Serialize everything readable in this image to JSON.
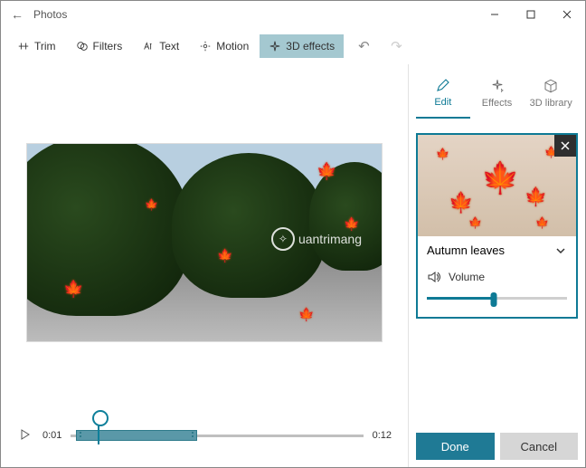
{
  "window": {
    "title": "Photos"
  },
  "toolbar": {
    "trim": "Trim",
    "filters": "Filters",
    "text": "Text",
    "motion": "Motion",
    "effects3d": "3D effects"
  },
  "timeline": {
    "current": "0:01",
    "duration": "0:12"
  },
  "watermark": "uantrimang",
  "side": {
    "tabs": {
      "edit": "Edit",
      "effects": "Effects",
      "library": "3D library"
    },
    "panel": {
      "name": "Autumn leaves",
      "volume_label": "Volume",
      "volume_pct": 48
    },
    "footer": {
      "done": "Done",
      "cancel": "Cancel"
    }
  }
}
